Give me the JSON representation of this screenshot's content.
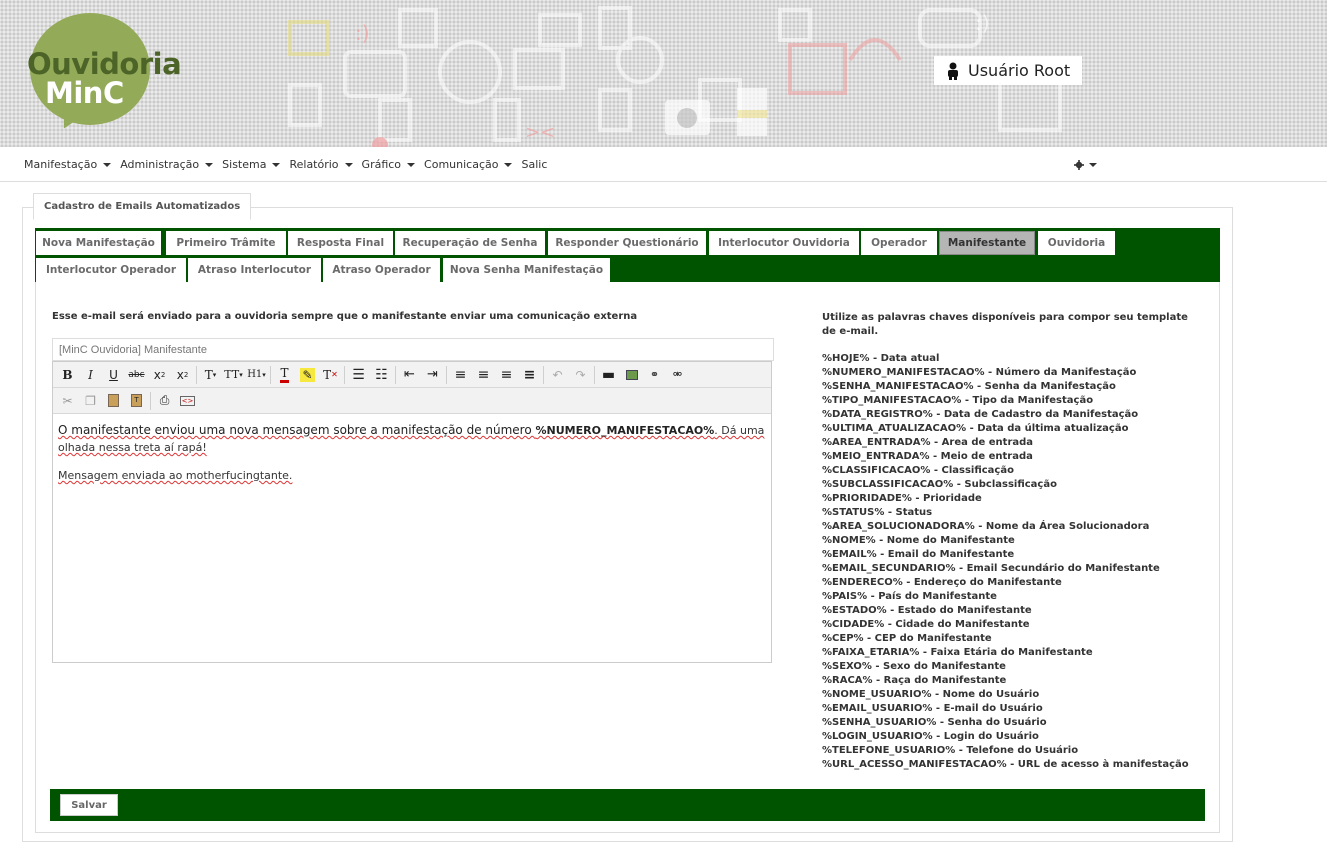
{
  "header": {
    "logo_line1": "Ouvidoria",
    "logo_line2": "MinC",
    "user_name": "Usuário Root"
  },
  "nav": {
    "items": [
      "Manifestação",
      "Administração",
      "Sistema",
      "Relatório",
      "Gráfico",
      "Comunicação",
      "Salic"
    ]
  },
  "panel": {
    "title": "Cadastro de Emails Automatizados"
  },
  "tabs": {
    "row1": [
      "Nova Manifestação",
      "Primeiro Trâmite",
      "Resposta Final",
      "Recuperação de Senha",
      "Responder Questionário",
      "Interlocutor Ouvidoria",
      "Operador",
      "Manifestante",
      "Ouvidoria"
    ],
    "row2": [
      "Interlocutor Operador",
      "Atraso Interlocutor",
      "Atraso Operador",
      "Nova Senha Manifestação"
    ],
    "active": "Manifestante"
  },
  "form": {
    "description": "Esse e-mail será enviado para a ouvidoria sempre que o manifestante enviar uma comunicação externa",
    "subject": "[MinC Ouvidoria] Manifestante",
    "body_part1": "O manifestante enviou uma nova mensagem sobre a manifestação de número ",
    "body_keyword": "%NUMERO_MANIFESTACAO%",
    "body_part2": ". Dá uma olhada nessa treta aí rapá!",
    "body_line2": "Mensagem enviada ao motherfucingtante.",
    "save_label": "Salvar"
  },
  "help": {
    "title": "Utilize as palavras chaves disponíveis para compor seu template de e-mail.",
    "keywords": [
      "%HOJE% - Data atual",
      "%NUMERO_MANIFESTACAO% - Número da Manifestação",
      "%SENHA_MANIFESTACAO% - Senha da Manifestação",
      "%TIPO_MANIFESTACAO% - Tipo da Manifestação",
      "%DATA_REGISTRO% - Data de Cadastro da Manifestação",
      "%ULTIMA_ATUALIZACAO% - Data da última atualização",
      "%AREA_ENTRADA% - Area de entrada",
      "%MEIO_ENTRADA% - Meio de entrada",
      "%CLASSIFICACAO% - Classificação",
      "%SUBCLASSIFICACAO% - Subclassificação",
      "%PRIORIDADE% - Prioridade",
      "%STATUS% - Status",
      "%AREA_SOLUCIONADORA% - Nome da Área Solucionadora",
      "%NOME% - Nome do Manifestante",
      "%EMAIL% - Email do Manifestante",
      "%EMAIL_SECUNDARIO% - Email Secundário do Manifestante",
      "%ENDERECO% - Endereço do Manifestante",
      "%PAIS% - País do Manifestante",
      "%ESTADO% - Estado do Manifestante",
      "%CIDADE% - Cidade do Manifestante",
      "%CEP% - CEP do Manifestante",
      "%FAIXA_ETARIA% - Faixa Etária do Manifestante",
      "%SEXO% - Sexo do Manifestante",
      "%RACA% - Raça do Manifestante",
      "%NOME_USUARIO% - Nome do Usuário",
      "%EMAIL_USUARIO% - E-mail do Usuário",
      "%SENHA_USUARIO% - Senha do Usuário",
      "%LOGIN_USUARIO% - Login do Usuário",
      "%TELEFONE_USUARIO% - Telefone do Usuário",
      "%URL_ACESSO_MANIFESTACAO% - URL de acesso à manifestação"
    ]
  },
  "colors": {
    "tab_bar": "#005400",
    "logo_green": "#93aa58",
    "logo_dark": "#4d6428"
  }
}
